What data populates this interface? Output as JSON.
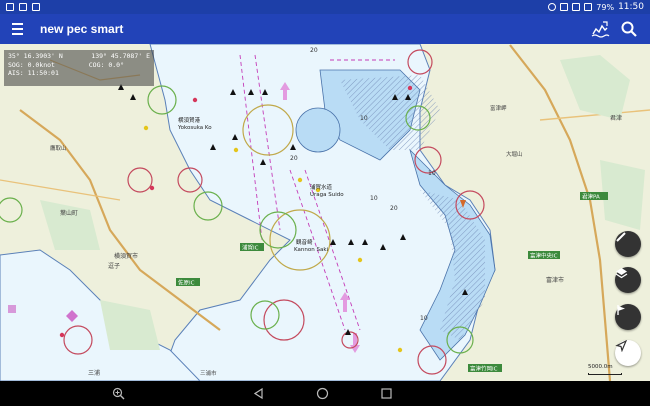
{
  "status_bar": {
    "battery": "79%",
    "time": "11:50"
  },
  "app_bar": {
    "title": "new pec smart",
    "menu_icon": "hamburger-menu-icon",
    "tide_icon": "tide-icon",
    "search_icon": "search-icon"
  },
  "info": {
    "lat": "35° 16.3903' N",
    "lon": "139° 45.7087' E",
    "sog": "SOG: 0.0knot",
    "cog": "COG: 0.0°",
    "ais": "AIS: 11:50:01"
  },
  "map_labels": {
    "yokosuka": "横須賀港",
    "yokosuka_en": "Yokosuka Ko",
    "uraga_suido": "浦賀水道",
    "uraga_suido_en": "Uraga Suido",
    "kannon": "観音崎",
    "kannon_en": "Kannon Saki",
    "uraga_ic": "浦賀IC",
    "sakuma": "佐原IC",
    "futtsu_nakajima": "富津中央IC",
    "futtsu_takeoka": "富津竹岡IC",
    "kisarazu": "君津",
    "miura": "三浦",
    "hayama": "葉山町",
    "zushi": "逗子",
    "yokosuka_city": "横須賀市",
    "futtsu": "富津市",
    "kimitsu_pa": "君津PA",
    "ohori": "大堀山",
    "mitsubishi": "三浦市",
    "takatori": "鷹取山",
    "futtsu_cape": "富津岬",
    "depth_20a": "20",
    "depth_20b": "20",
    "depth_20c": "20",
    "depth_10a": "10",
    "depth_10b": "10",
    "depth_10c": "10",
    "depth_10d": "10",
    "scale": "5000.0m"
  },
  "fabs": {
    "ruler": "ruler-icon",
    "layers": "layers-icon",
    "flag": "flag-icon",
    "navigate": "navigation-arrow-icon"
  },
  "nav_bar": {
    "zoom": "zoom-icon",
    "back": "back-icon",
    "home": "home-icon",
    "recents": "recents-icon"
  },
  "colors": {
    "app_bar": "#2243b8",
    "status_bar": "#1d3fa8",
    "water": "#e8f5ff",
    "land": "#f2f0e6",
    "shallow": "#b9dcf5",
    "route": "#c43cb8"
  }
}
